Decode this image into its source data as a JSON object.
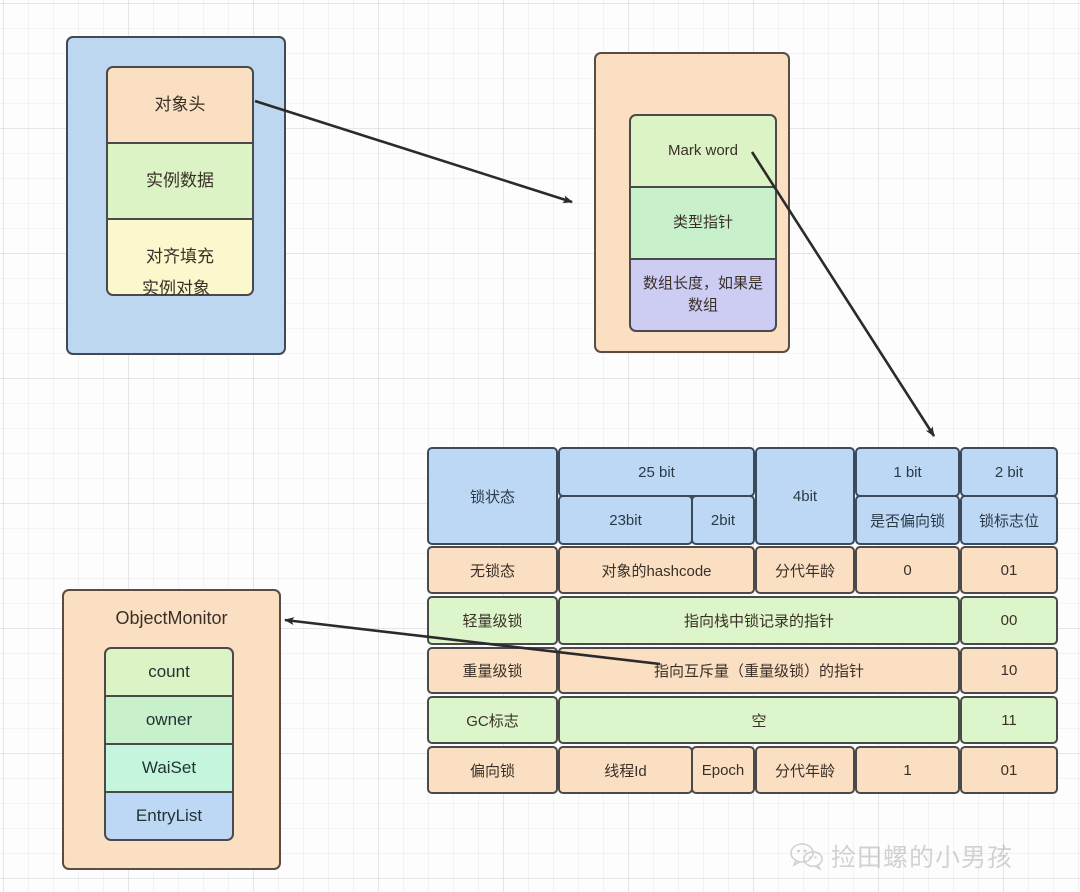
{
  "instance_object": {
    "caption": "实例对象",
    "cells": [
      {
        "label": "对象头",
        "color": "#fadfc3"
      },
      {
        "label": "实例数据",
        "color": "#dcf3c6"
      },
      {
        "label": "对齐填充",
        "color": "#fbf8cd"
      }
    ]
  },
  "object_header": {
    "cells": [
      {
        "label": "Mark  word",
        "color": "#dcf3c6"
      },
      {
        "label": "类型指针",
        "color": "#c8f0ca"
      },
      {
        "label": "数组长度，如果是数组",
        "color": "#cdcdf3"
      }
    ]
  },
  "object_monitor": {
    "title": "ObjectMonitor",
    "cells": [
      {
        "label": "count",
        "color": "#dcf3c6"
      },
      {
        "label": "owner",
        "color": "#c8f0ca"
      },
      {
        "label": "WaiSet",
        "color": "#c6f5dd"
      },
      {
        "label": "EntryList",
        "color": "#bcd8f4"
      }
    ]
  },
  "mark_word_table": {
    "header": {
      "state_label": "锁状态",
      "bit25": "25 bit",
      "bit23": "23bit",
      "bit2_sub": "2bit",
      "bit4": "4bit",
      "bit1": "1 bit",
      "bit1_sub": "是否偏向锁",
      "bit2": "2 bit",
      "bit2_sub_flag": "锁标志位"
    },
    "rows": [
      {
        "state": "无锁态",
        "color": "#fadfc3",
        "cells": [
          "对象的hashcode",
          "分代年龄",
          "0",
          "01"
        ]
      },
      {
        "state": "轻量级锁",
        "color": "#ddf5ca",
        "cells": [
          "指向栈中锁记录的指针",
          "00"
        ]
      },
      {
        "state": "重量级锁",
        "color": "#fadfc3",
        "cells": [
          "指向互斥量（重量级锁）的指针",
          "10"
        ]
      },
      {
        "state": "GC标志",
        "color": "#ddf5ca",
        "cells": [
          "空",
          "11"
        ]
      },
      {
        "state": "偏向锁",
        "color": "#fadfc3",
        "cells": [
          "线程Id",
          "Epoch",
          "分代年龄",
          "1",
          "01"
        ]
      }
    ]
  },
  "watermark": {
    "text": "捡田螺的小男孩"
  },
  "colors": {
    "blue_container": "#bdd7f0",
    "peach_container": "#fadfc3",
    "stroke": "#4a4a4a",
    "background": "#fdfdfd"
  }
}
